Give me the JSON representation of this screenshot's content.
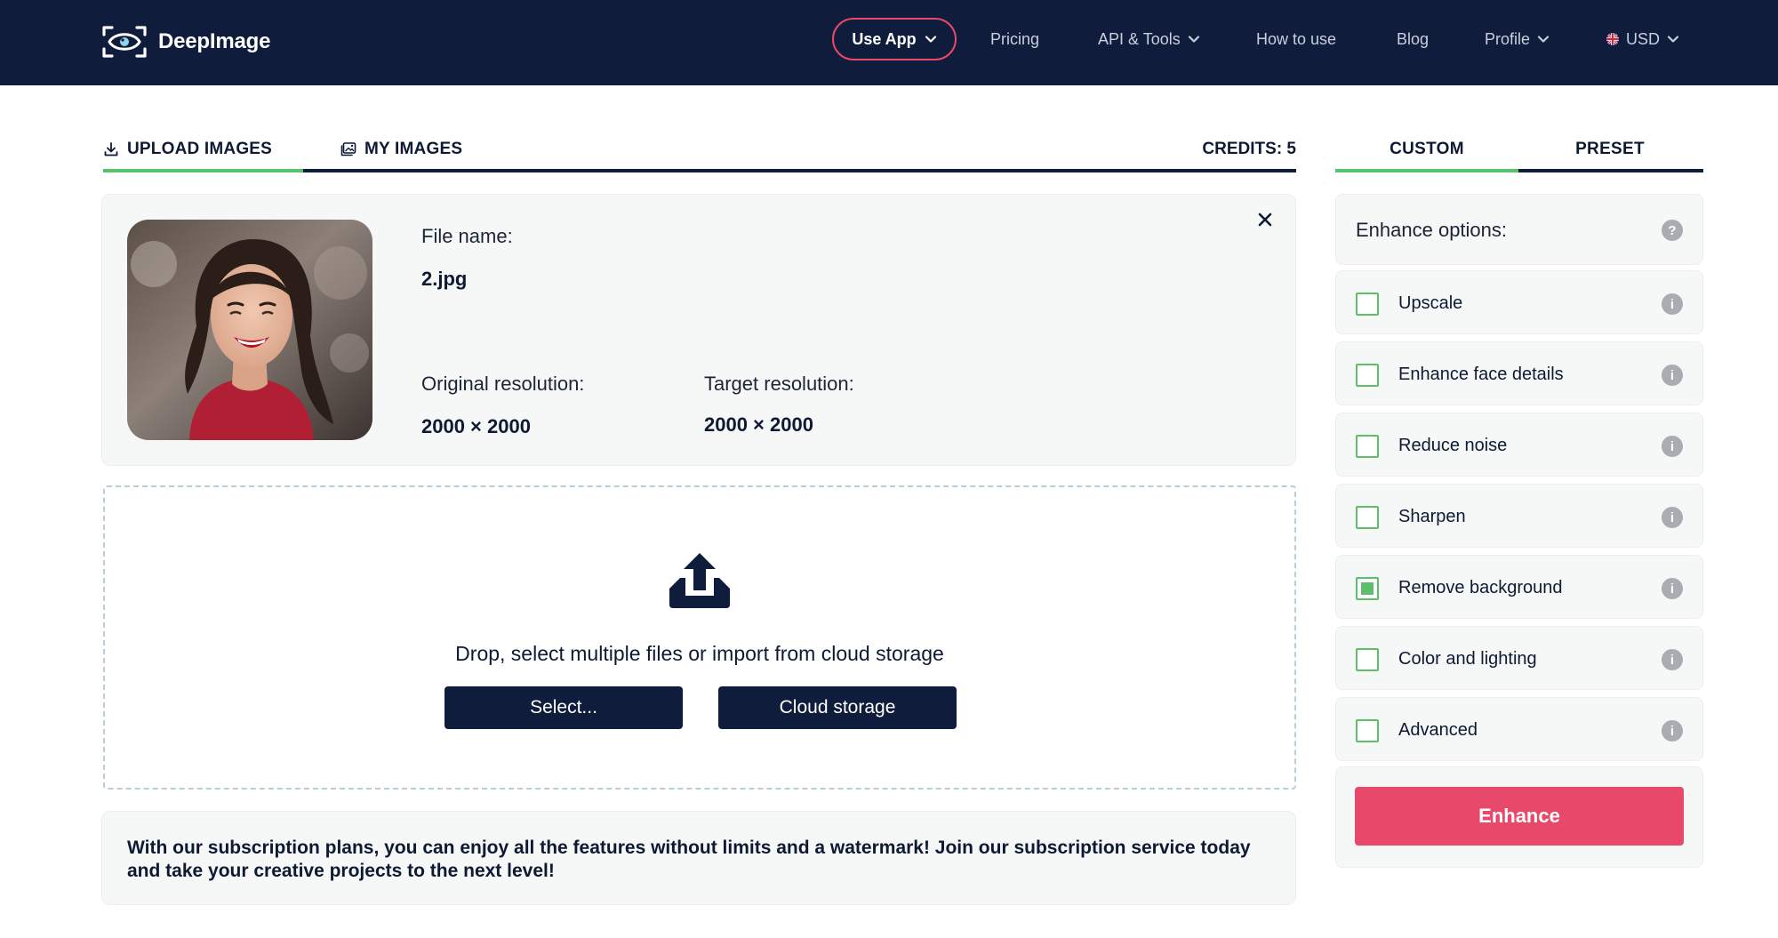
{
  "app": {
    "brand": "DeepImage"
  },
  "nav": {
    "use_app": "Use App",
    "pricing": "Pricing",
    "api_tools": "API & Tools",
    "how_to_use": "How to use",
    "blog": "Blog",
    "profile": "Profile",
    "currency": "USD"
  },
  "tabs": {
    "upload": "UPLOAD IMAGES",
    "my_images": "MY IMAGES",
    "credits": "CREDITS: 5"
  },
  "file": {
    "name_label": "File name:",
    "name": "2.jpg",
    "orig_label": "Original resolution:",
    "orig": "2000 × 2000",
    "target_label": "Target resolution:",
    "target": "2000 × 2000"
  },
  "drop": {
    "text": "Drop, select multiple files or import from cloud storage",
    "select": "Select...",
    "cloud": "Cloud storage"
  },
  "promo": {
    "text": "With our subscription plans, you can enjoy all the features without limits and a watermark! Join our subscription service today and take your creative projects to the next level!"
  },
  "panel": {
    "tab_custom": "CUSTOM",
    "tab_preset": "PRESET",
    "title": "Enhance options:",
    "help": "?",
    "info": "i",
    "options": [
      {
        "label": "Upscale",
        "checked": false
      },
      {
        "label": "Enhance face details",
        "checked": false
      },
      {
        "label": "Reduce noise",
        "checked": false
      },
      {
        "label": "Sharpen",
        "checked": false
      },
      {
        "label": "Remove background",
        "checked": true
      },
      {
        "label": "Color and lighting",
        "checked": false
      },
      {
        "label": "Advanced",
        "checked": false
      }
    ],
    "enhance": "Enhance"
  },
  "colors": {
    "navy": "#0f1c3c",
    "accent_pink": "#e8496a",
    "accent_green": "#5cbf6c"
  },
  "icons": {
    "logo": "eye-scan-icon",
    "chevron": "chevron-down-icon",
    "flag": "uk-flag-icon",
    "upload_tab": "download-tray-icon",
    "images_tab": "image-gallery-icon",
    "close": "close-icon",
    "upload_zone": "upload-tray-icon",
    "info": "info-icon",
    "help": "help-icon"
  }
}
